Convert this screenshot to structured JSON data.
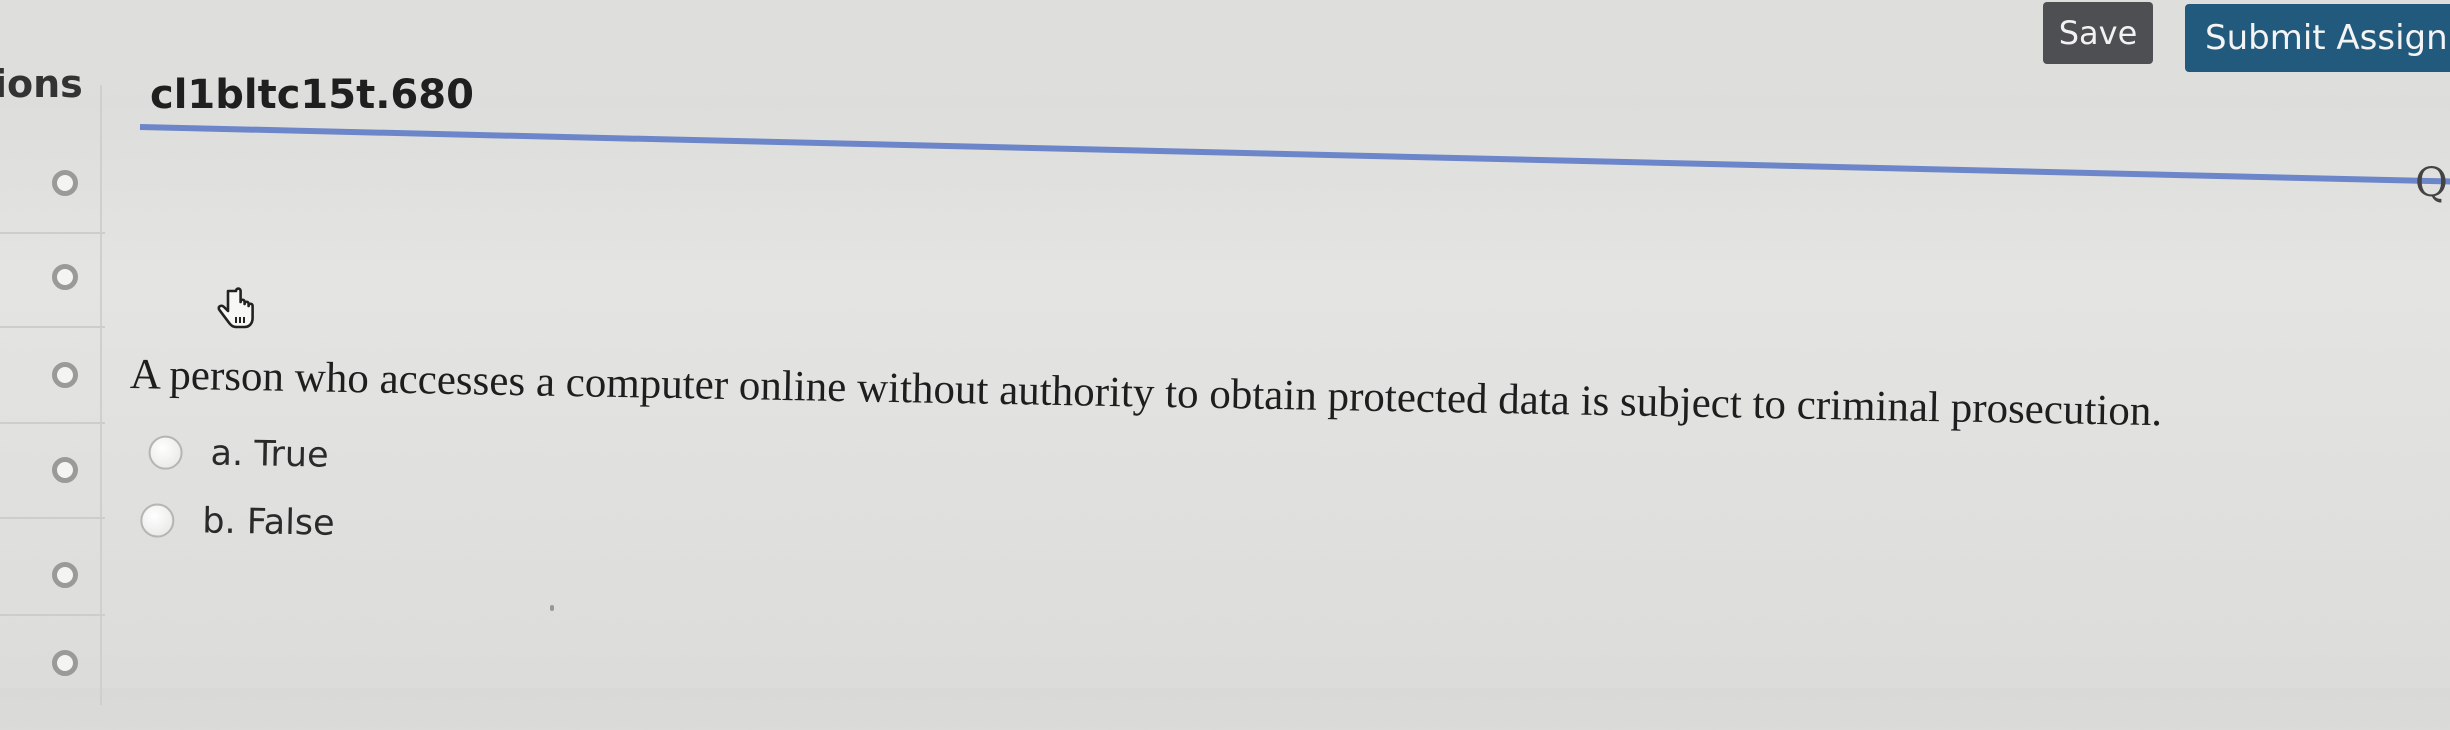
{
  "toolbar": {
    "save_label": "Save",
    "submit_label": "Submit Assignr"
  },
  "sidebar": {
    "title": "ions",
    "items": [
      {
        "state": "unanswered"
      },
      {
        "state": "unanswered"
      },
      {
        "state": "unanswered"
      },
      {
        "state": "unanswered"
      },
      {
        "state": "unanswered"
      },
      {
        "state": "unanswered"
      }
    ]
  },
  "header": {
    "title": "cl1bltc15t.680",
    "right_glyph": "Q"
  },
  "question": {
    "text": "A person who accesses a computer online without authority to obtain protected data is subject to criminal prosecution.",
    "options": [
      {
        "label": "a. True"
      },
      {
        "label": "b. False"
      }
    ]
  },
  "colors": {
    "save_bg": "#4d4f52",
    "submit_bg": "#215a7c",
    "underline": "#6c86c9"
  }
}
